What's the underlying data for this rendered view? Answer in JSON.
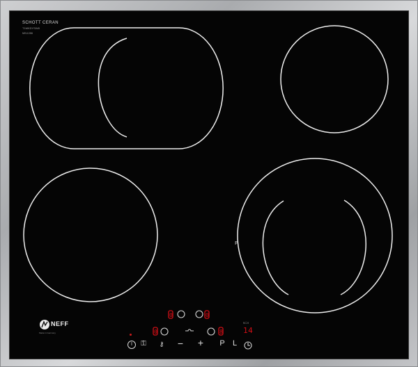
{
  "hob": {
    "surface_brand": "SCHOTT CERAN",
    "surface_model": "T1MKDYSW8",
    "surface_batch": "MN1286",
    "brand_logo": "NEFF",
    "brand_sub": "Made in Germany",
    "zone_labels": {
      "center_marker": "P"
    },
    "indicators": {
      "timer_display": "14",
      "timer_unit": "min",
      "left_display": "0",
      "middle_display": "8",
      "upper_left_display": "0",
      "upper_right_display": "0"
    },
    "controls": {
      "power": "I",
      "childlock": "⚿",
      "minus": "−",
      "plus": "+",
      "program": "P",
      "lock": "L"
    },
    "colors": {
      "glass": "#050505",
      "ring": "#ececec",
      "led": "#d30f16",
      "frame": "#b9bbbe"
    }
  }
}
